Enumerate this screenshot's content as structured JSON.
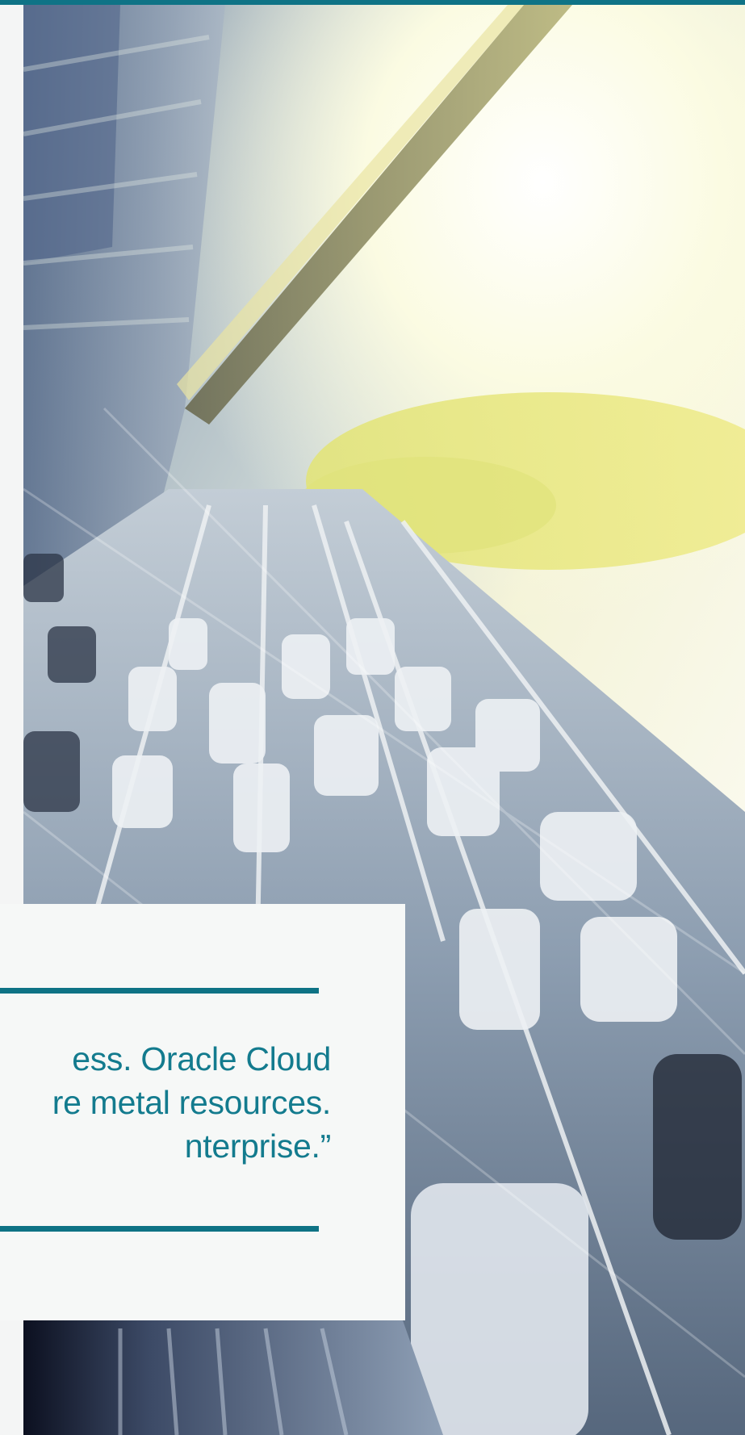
{
  "colors": {
    "accent": "#0f7386",
    "quote_text": "#137b8e",
    "card_background": "#f6f8f7"
  },
  "photo": {
    "subject": "blurred-highway-traffic-photo"
  },
  "quote": {
    "lines": [
      "ess. Oracle Cloud",
      "re metal resources.",
      "nterprise.”"
    ]
  }
}
